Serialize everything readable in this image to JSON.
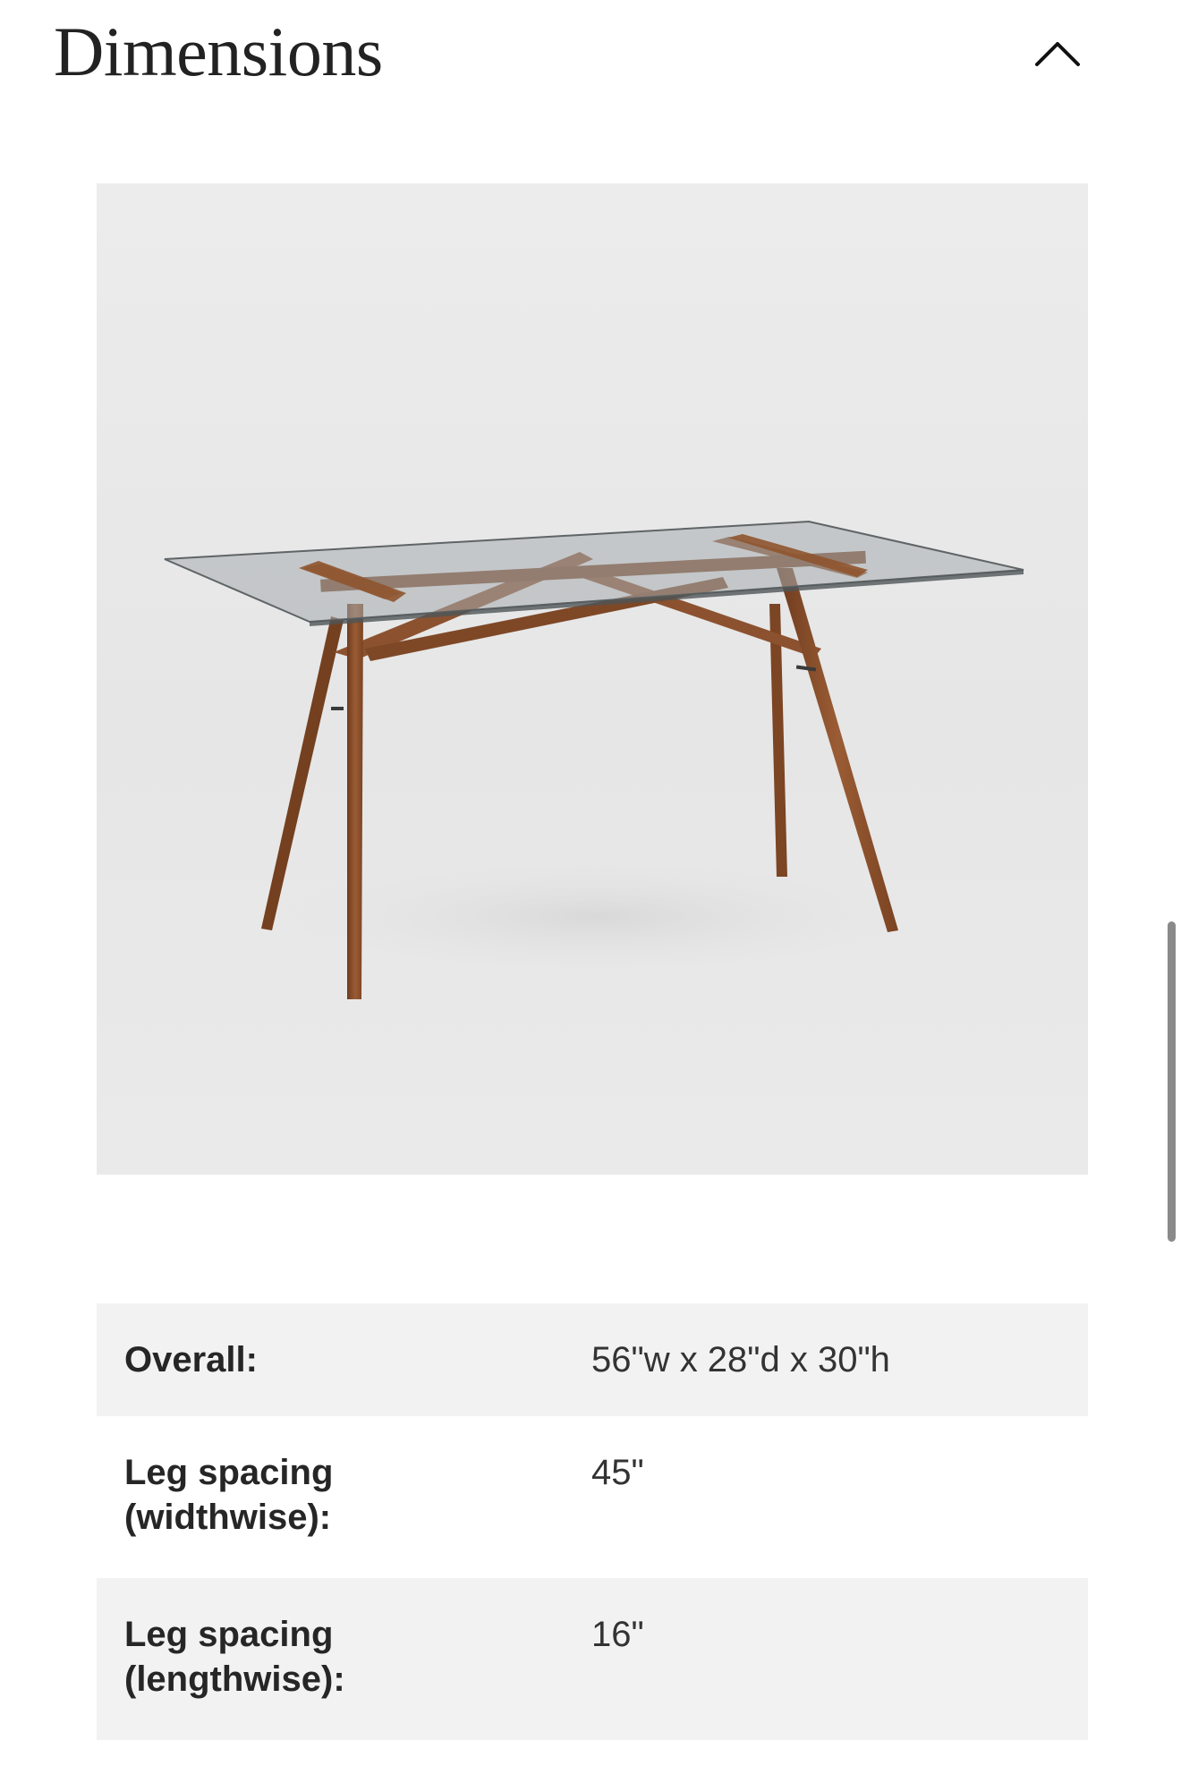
{
  "section": {
    "title": "Dimensions",
    "toggle_icon": "chevron-up-icon"
  },
  "product_image": {
    "alt": "Glass-top table with wooden legs"
  },
  "dimensions": {
    "rows": [
      {
        "label": "Overall:",
        "value": "56\"w x 28\"d x 30\"h"
      },
      {
        "label": "Leg spacing\n(widthwise):",
        "value": "45\""
      },
      {
        "label": "Leg spacing\n(lengthwise):",
        "value": "16\""
      }
    ]
  },
  "colors": {
    "row_shade": "#f2f2f2",
    "wood": "#8a4f2a",
    "glass": "#9ea4a6"
  }
}
